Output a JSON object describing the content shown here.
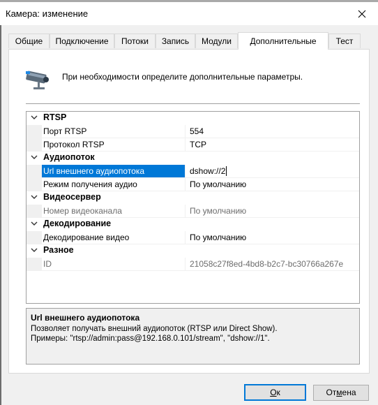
{
  "window": {
    "title": "Камера: изменение"
  },
  "tabs": [
    {
      "label": "Общие"
    },
    {
      "label": "Подключение"
    },
    {
      "label": "Потоки"
    },
    {
      "label": "Запись"
    },
    {
      "label": "Модули"
    },
    {
      "label": "Дополнительные"
    },
    {
      "label": "Тест"
    }
  ],
  "active_tab": "Дополнительные",
  "hint": {
    "text": "При необходимости определите дополнительные параметры.",
    "icon": "camera-icon"
  },
  "grid": {
    "rows": [
      {
        "type": "category",
        "label": "RTSP"
      },
      {
        "type": "prop",
        "label": "Порт RTSP",
        "value": "554"
      },
      {
        "type": "prop",
        "label": "Протокол RTSP",
        "value": "TCP"
      },
      {
        "type": "category",
        "label": "Аудиопоток"
      },
      {
        "type": "prop",
        "label": "Url внешнего аудиопотока",
        "value": "dshow://2",
        "selected": true
      },
      {
        "type": "prop",
        "label": "Режим получения аудио",
        "value": "По умолчанию"
      },
      {
        "type": "category",
        "label": "Видеосервер"
      },
      {
        "type": "prop",
        "label": "Номер видеоканала",
        "value": "По умолчанию",
        "disabled": true
      },
      {
        "type": "category",
        "label": "Декодирование"
      },
      {
        "type": "prop",
        "label": "Декодирование видео",
        "value": "По умолчанию"
      },
      {
        "type": "category",
        "label": "Разное"
      },
      {
        "type": "prop",
        "label": "ID",
        "value": "21058c27f8ed-4bd8-b2c7-bc30766a267e",
        "disabled": true
      }
    ]
  },
  "description": {
    "title": "Url внешнего аудиопотока",
    "line1": "Позволяет получать внешний аудиопоток (RTSP или Direct Show).",
    "line2": "Примеры: \"rtsp://admin:pass@192.168.0.101/stream\", \"dshow://1\"."
  },
  "buttons": {
    "ok_prefix": "",
    "ok_accel": "О",
    "ok_rest": "к",
    "cancel_prefix": "От",
    "cancel_accel": "м",
    "cancel_rest": "ена"
  }
}
